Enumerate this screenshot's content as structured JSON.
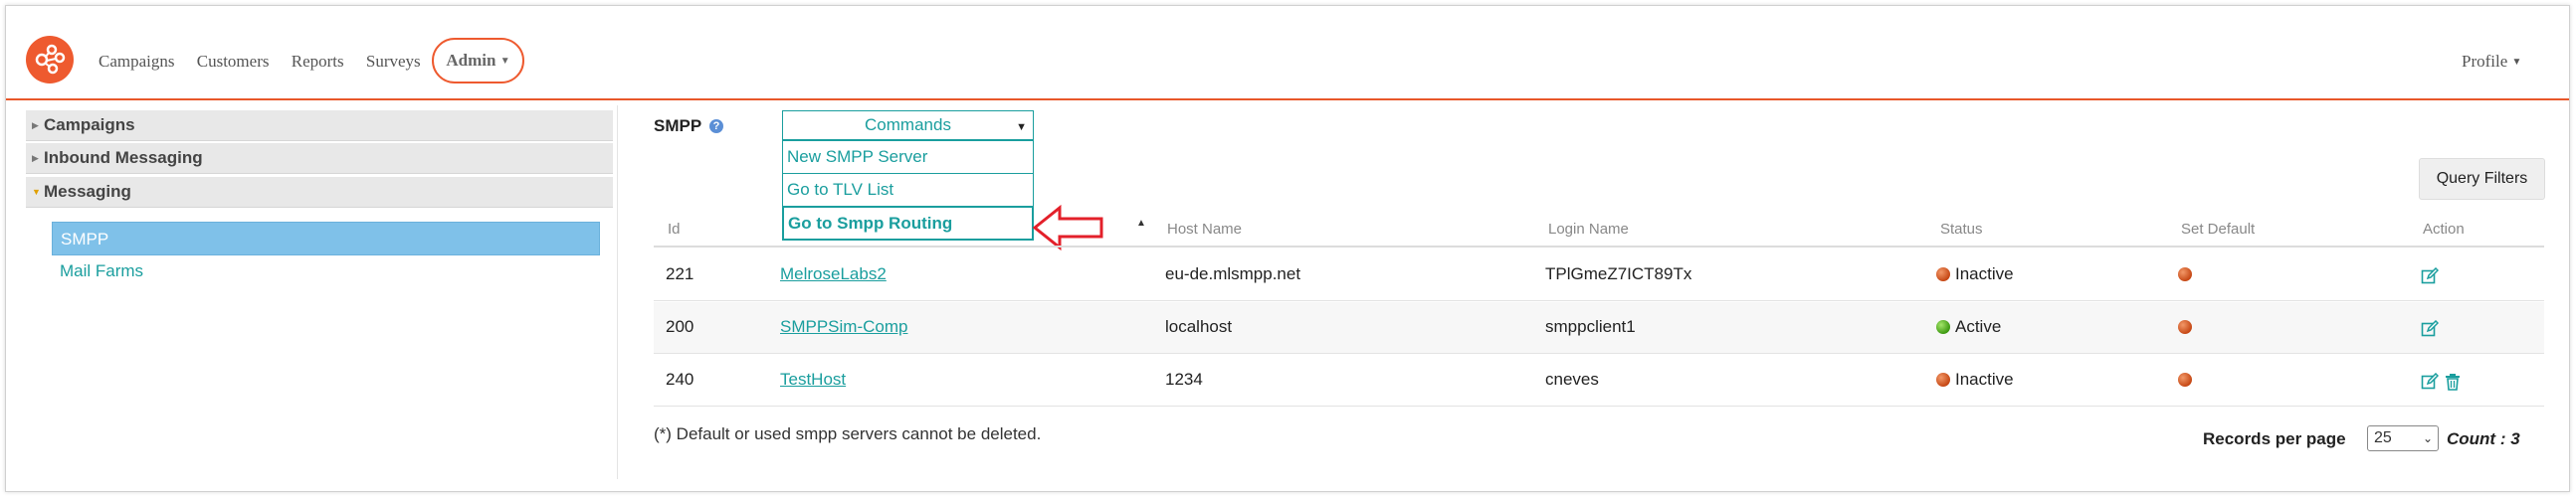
{
  "nav": {
    "links": [
      "Campaigns",
      "Customers",
      "Reports",
      "Surveys"
    ],
    "admin_label": "Admin",
    "profile_label": "Profile",
    "accent_color": "#ee5a2f"
  },
  "sidebar": {
    "groups": [
      {
        "label": "Campaigns",
        "expanded": false
      },
      {
        "label": "Inbound Messaging",
        "expanded": false
      },
      {
        "label": "Messaging",
        "expanded": true
      }
    ],
    "items": [
      {
        "label": "SMPP",
        "active": true
      },
      {
        "label": "Mail Farms",
        "active": false
      }
    ]
  },
  "main": {
    "title": "SMPP",
    "help_icon": "question-circle-icon",
    "commands": {
      "label": "Commands",
      "items": [
        "New SMPP Server",
        "Go to TLV List",
        "Go to Smpp Routing"
      ]
    },
    "query_filters_label": "Query Filters"
  },
  "table": {
    "headers": [
      "Id",
      "Host Name",
      "Login Name",
      "Status",
      "Set Default",
      "Action"
    ],
    "rows": [
      {
        "id": "221",
        "name": "MelroseLabs2",
        "host": "eu-de.mlsmpp.net",
        "login": "TPlGmeZ7ICT89Tx",
        "status": "Inactive",
        "status_color": "#d65a20",
        "deletable": false
      },
      {
        "id": "200",
        "name": "SMPPSim-Comp",
        "host": "localhost",
        "login": "smppclient1",
        "status": "Active",
        "status_color": "#4caf1a",
        "deletable": false
      },
      {
        "id": "240",
        "name": "TestHost",
        "host": "1234",
        "login": "cneves",
        "status": "Inactive",
        "status_color": "#d65a20",
        "deletable": true
      }
    ]
  },
  "footer": {
    "note": "(*) Default or used smpp servers cannot be deleted.",
    "records_per_page_label": "Records per page",
    "records_per_page_value": "25",
    "count_label": "Count",
    "count_separator": ":",
    "count_value": "3"
  }
}
